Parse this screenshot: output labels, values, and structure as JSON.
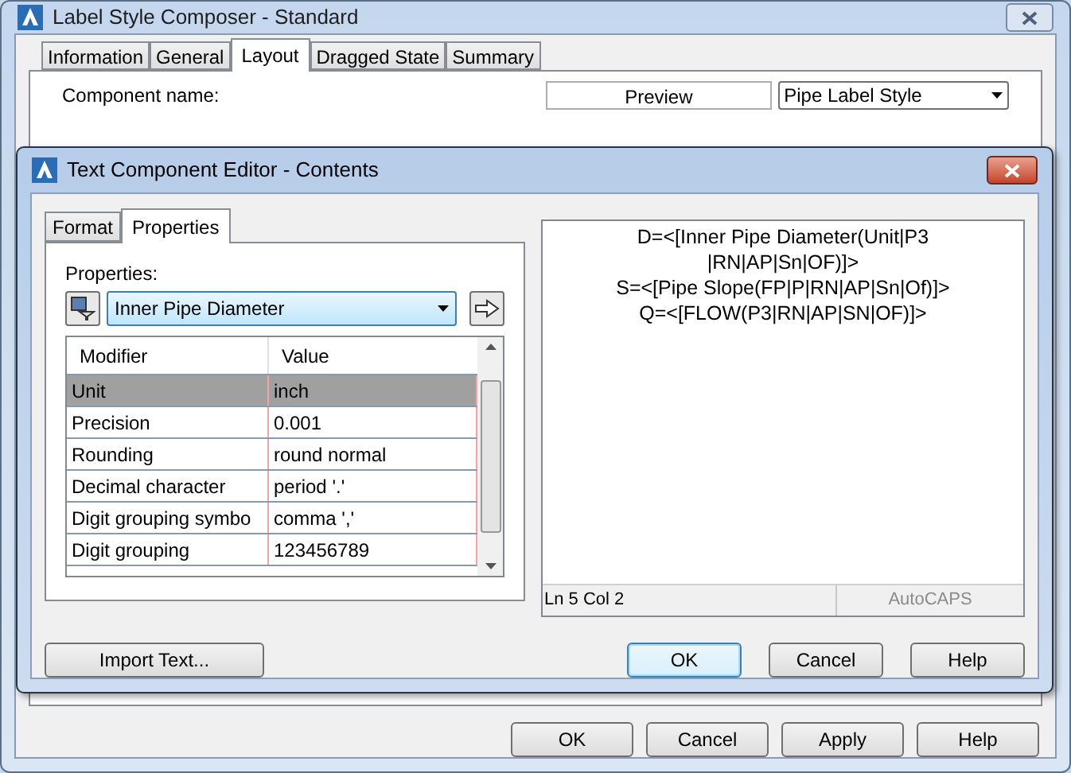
{
  "window": {
    "title": "Label Style Composer - Standard"
  },
  "tabs": [
    {
      "label": "Information",
      "selected": false
    },
    {
      "label": "General",
      "selected": false
    },
    {
      "label": "Layout",
      "selected": true
    },
    {
      "label": "Dragged State",
      "selected": false
    },
    {
      "label": "Summary",
      "selected": false
    }
  ],
  "component_name_label": "Component name:",
  "preview_button": "Preview",
  "style_dropdown": {
    "value": "Pipe Label Style"
  },
  "dialog": {
    "title": "Text Component Editor - Contents",
    "tabs": [
      {
        "label": "Format",
        "selected": false
      },
      {
        "label": "Properties",
        "selected": true
      }
    ],
    "properties_label": "Properties:",
    "property_select": {
      "value": "Inner Pipe Diameter"
    },
    "grid": {
      "columns": [
        "Modifier",
        "Value"
      ],
      "rows": [
        {
          "modifier": "Unit",
          "value": "inch",
          "selected": true
        },
        {
          "modifier": "Precision",
          "value": "0.001",
          "selected": false
        },
        {
          "modifier": "Rounding",
          "value": "round normal",
          "selected": false
        },
        {
          "modifier": "Decimal character",
          "value": "period '.'",
          "selected": false
        },
        {
          "modifier": "Digit grouping symbo",
          "value": "comma ','",
          "selected": false
        },
        {
          "modifier": "Digit grouping",
          "value": "123456789",
          "selected": false
        }
      ]
    },
    "editor": {
      "lines": [
        "D=<[Inner Pipe Diameter(Unit|P3",
        "|RN|AP|Sn|OF)]>",
        "S=<[Pipe Slope(FP|P|RN|AP|Sn|Of)]>",
        "Q=<[FLOW(P3|RN|AP|SN|OF)]>"
      ],
      "status": "Ln 5 Col 2",
      "mode": "AutoCAPS"
    },
    "buttons": [
      {
        "label": "Import Text...",
        "default": false
      },
      {
        "label": "OK",
        "default": true
      },
      {
        "label": "Cancel",
        "default": false
      },
      {
        "label": "Help",
        "default": false
      }
    ]
  },
  "buttons": [
    {
      "label": "OK"
    },
    {
      "label": "Cancel"
    },
    {
      "label": "Apply"
    },
    {
      "label": "Help"
    }
  ]
}
